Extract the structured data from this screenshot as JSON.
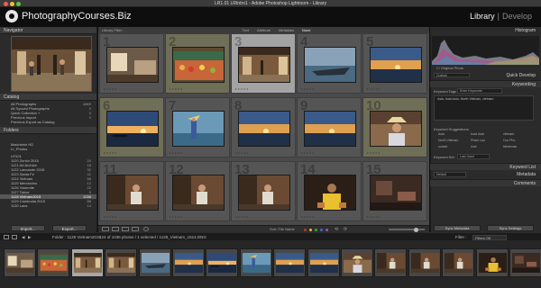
{
  "window": {
    "title": "LR1.01 LRIntro1 - Adobe Photoshop Lightroom - Library"
  },
  "brand": {
    "name": "PhotographyCourses.Biz"
  },
  "modules": {
    "active": "Library",
    "other": "Develop",
    "separator": "|"
  },
  "left_panel": {
    "navigator": "Navigator",
    "catalog": {
      "title": "Catalog",
      "items": [
        {
          "label": "All Photographs",
          "count": "4869"
        },
        {
          "label": "All Synced Photographs",
          "count": "0"
        },
        {
          "label": "Quick Collection +",
          "count": "0"
        },
        {
          "label": "Previous Import",
          "count": "0"
        },
        {
          "label": "Previous Export as Catalog",
          "count": ""
        }
      ]
    },
    "folders": {
      "title": "Folders",
      "items": [
        {
          "label": "Macintosh HD",
          "count": ""
        },
        {
          "label": "Lr_Photos",
          "count": ""
        },
        {
          "label": "LR101",
          "count": ""
        },
        {
          "label": "1120 Zurich 2015",
          "count": "24"
        },
        {
          "label": "1121 Art Archive",
          "count": "18"
        },
        {
          "label": "1122 Lancaster 2015",
          "count": "32"
        },
        {
          "label": "1123 Santa Fe",
          "count": "41"
        },
        {
          "label": "1124 Vietnam",
          "count": "56"
        },
        {
          "label": "1125 Mendocino",
          "count": "12"
        },
        {
          "label": "1126 Yosemite",
          "count": "22"
        },
        {
          "label": "1127 Tahoe",
          "count": "9"
        },
        {
          "label": "1128 Vietnam2015",
          "count": "1036"
        },
        {
          "label": "1129 Cambodia 2015",
          "count": "88"
        },
        {
          "label": "1130 Laos",
          "count": "14"
        }
      ]
    },
    "import_label": "Import...",
    "export_label": "Export..."
  },
  "grid": {
    "filter_label": "Library Filter :",
    "filter_options": [
      "Text",
      "Attribute",
      "Metadata",
      "None"
    ],
    "cells": [
      {
        "num": "1",
        "state": "normal",
        "scene": "room"
      },
      {
        "num": "2",
        "state": "lit",
        "scene": "market"
      },
      {
        "num": "3",
        "state": "sel",
        "scene": "interior"
      },
      {
        "num": "4",
        "state": "normal",
        "scene": "boat"
      },
      {
        "num": "5",
        "state": "normal",
        "scene": "sunset"
      },
      {
        "num": "6",
        "state": "lit",
        "scene": "sunset-wide"
      },
      {
        "num": "7",
        "state": "normal",
        "scene": "fisherman"
      },
      {
        "num": "8",
        "state": "normal",
        "scene": "sunset"
      },
      {
        "num": "9",
        "state": "normal",
        "scene": "sunset"
      },
      {
        "num": "10",
        "state": "lit",
        "scene": "portrait"
      },
      {
        "num": "11",
        "state": "normal",
        "scene": "elder"
      },
      {
        "num": "12",
        "state": "normal",
        "scene": "elder"
      },
      {
        "num": "13",
        "state": "normal",
        "scene": "elder"
      },
      {
        "num": "14",
        "state": "normal",
        "scene": "yellow"
      },
      {
        "num": "15",
        "state": "normal",
        "scene": "dark-interior"
      }
    ]
  },
  "toolbar": {
    "sort_label": "Sort: File Name"
  },
  "right_panel": {
    "histogram": "Histogram",
    "original": "Original Photo",
    "saved_preset": "Custom",
    "quick_develop": "Quick Develop",
    "keywording": "Keywording",
    "keyword_tags": "Keyword Tags",
    "keyword_tags_option": "Enter Keywords",
    "keyword_text": "Asia, boat dock, North Vietnam, vietnam",
    "keyword_suggestions": "Keyword Suggestions",
    "suggestions": [
      "Asia",
      "boat dock",
      "vietnam",
      "North Vietnam",
      "Pham Lao",
      "Cuc Pho",
      "sunset",
      "river",
      "fisherman"
    ],
    "keyword_set": "Keyword Set",
    "keyword_set_value": "Last Used",
    "keyword_list": "Keyword List",
    "metadata": "Metadata",
    "metadata_preset": "Default",
    "comments": "Comments",
    "sync_meta": "Sync Metadata",
    "sync_settings": "Sync Settings"
  },
  "status": {
    "folder_text": "Folder : 1128 Vietnam2015",
    "info_text": "124 of 1036 photos / 1 selected / 1128_Vietnam_1514.DNG",
    "filter_label": "Filter :",
    "filter_value": "Filters Off"
  },
  "filmstrip": {
    "count": 16
  }
}
